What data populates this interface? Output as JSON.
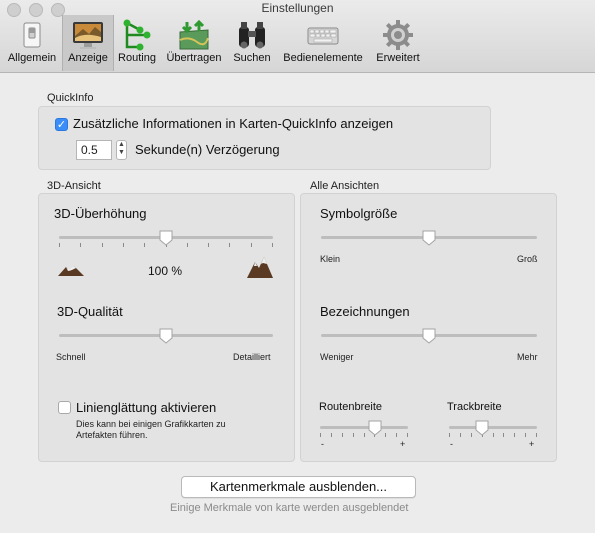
{
  "window": {
    "title": "Einstellungen"
  },
  "tabs": [
    {
      "label": "Allgemein",
      "icon": "switch-icon"
    },
    {
      "label": "Anzeige",
      "icon": "display-icon"
    },
    {
      "label": "Routing",
      "icon": "routing-icon"
    },
    {
      "label": "Übertragen",
      "icon": "transfer-icon"
    },
    {
      "label": "Suchen",
      "icon": "binoculars-icon"
    },
    {
      "label": "Bedienelemente",
      "icon": "keyboard-icon"
    },
    {
      "label": "Erweitert",
      "icon": "gear-icon"
    }
  ],
  "active_tab": "Anzeige",
  "quickinfo": {
    "title": "QuickInfo",
    "checkbox_label": "Zusätzliche Informationen in Karten-QuickInfo anzeigen",
    "checked": true,
    "delay_value": "0.5",
    "delay_label": "Sekunde(n) Verzögerung"
  },
  "view3d": {
    "title": "3D-Ansicht",
    "exaggeration_label": "3D-Überhöhung",
    "exaggeration_value": "100 %",
    "exaggeration_level": 0.5,
    "quality_label": "3D-Qualität",
    "quality_min": "Schnell",
    "quality_max": "Detailliert",
    "quality_level": 0.5,
    "smoothing_label": "Linienglättung aktivieren",
    "smoothing_checked": false,
    "smoothing_note_1": "Dies kann bei einigen Grafikkarten zu",
    "smoothing_note_2": "Artefakten führen."
  },
  "all_views": {
    "title": "Alle Ansichten",
    "symbol_size_label": "Symbolgröße",
    "symbol_min": "Klein",
    "symbol_max": "Groß",
    "symbol_level": 0.5,
    "labels_label": "Bezeichnungen",
    "labels_min": "Weniger",
    "labels_max": "Mehr",
    "labels_level": 0.5,
    "route_width_label": "Routenbreite",
    "route_width_level": 0.65,
    "track_width_label": "Trackbreite",
    "track_width_level": 0.35,
    "minus": "-",
    "plus": "+"
  },
  "footer": {
    "button_label": "Kartenmerkmale ausblenden...",
    "note": "Einige Merkmale von karte werden ausgeblendet"
  },
  "colors": {
    "accent": "#3b8df7",
    "panel": "#e3e3e3",
    "window": "#ececec"
  }
}
